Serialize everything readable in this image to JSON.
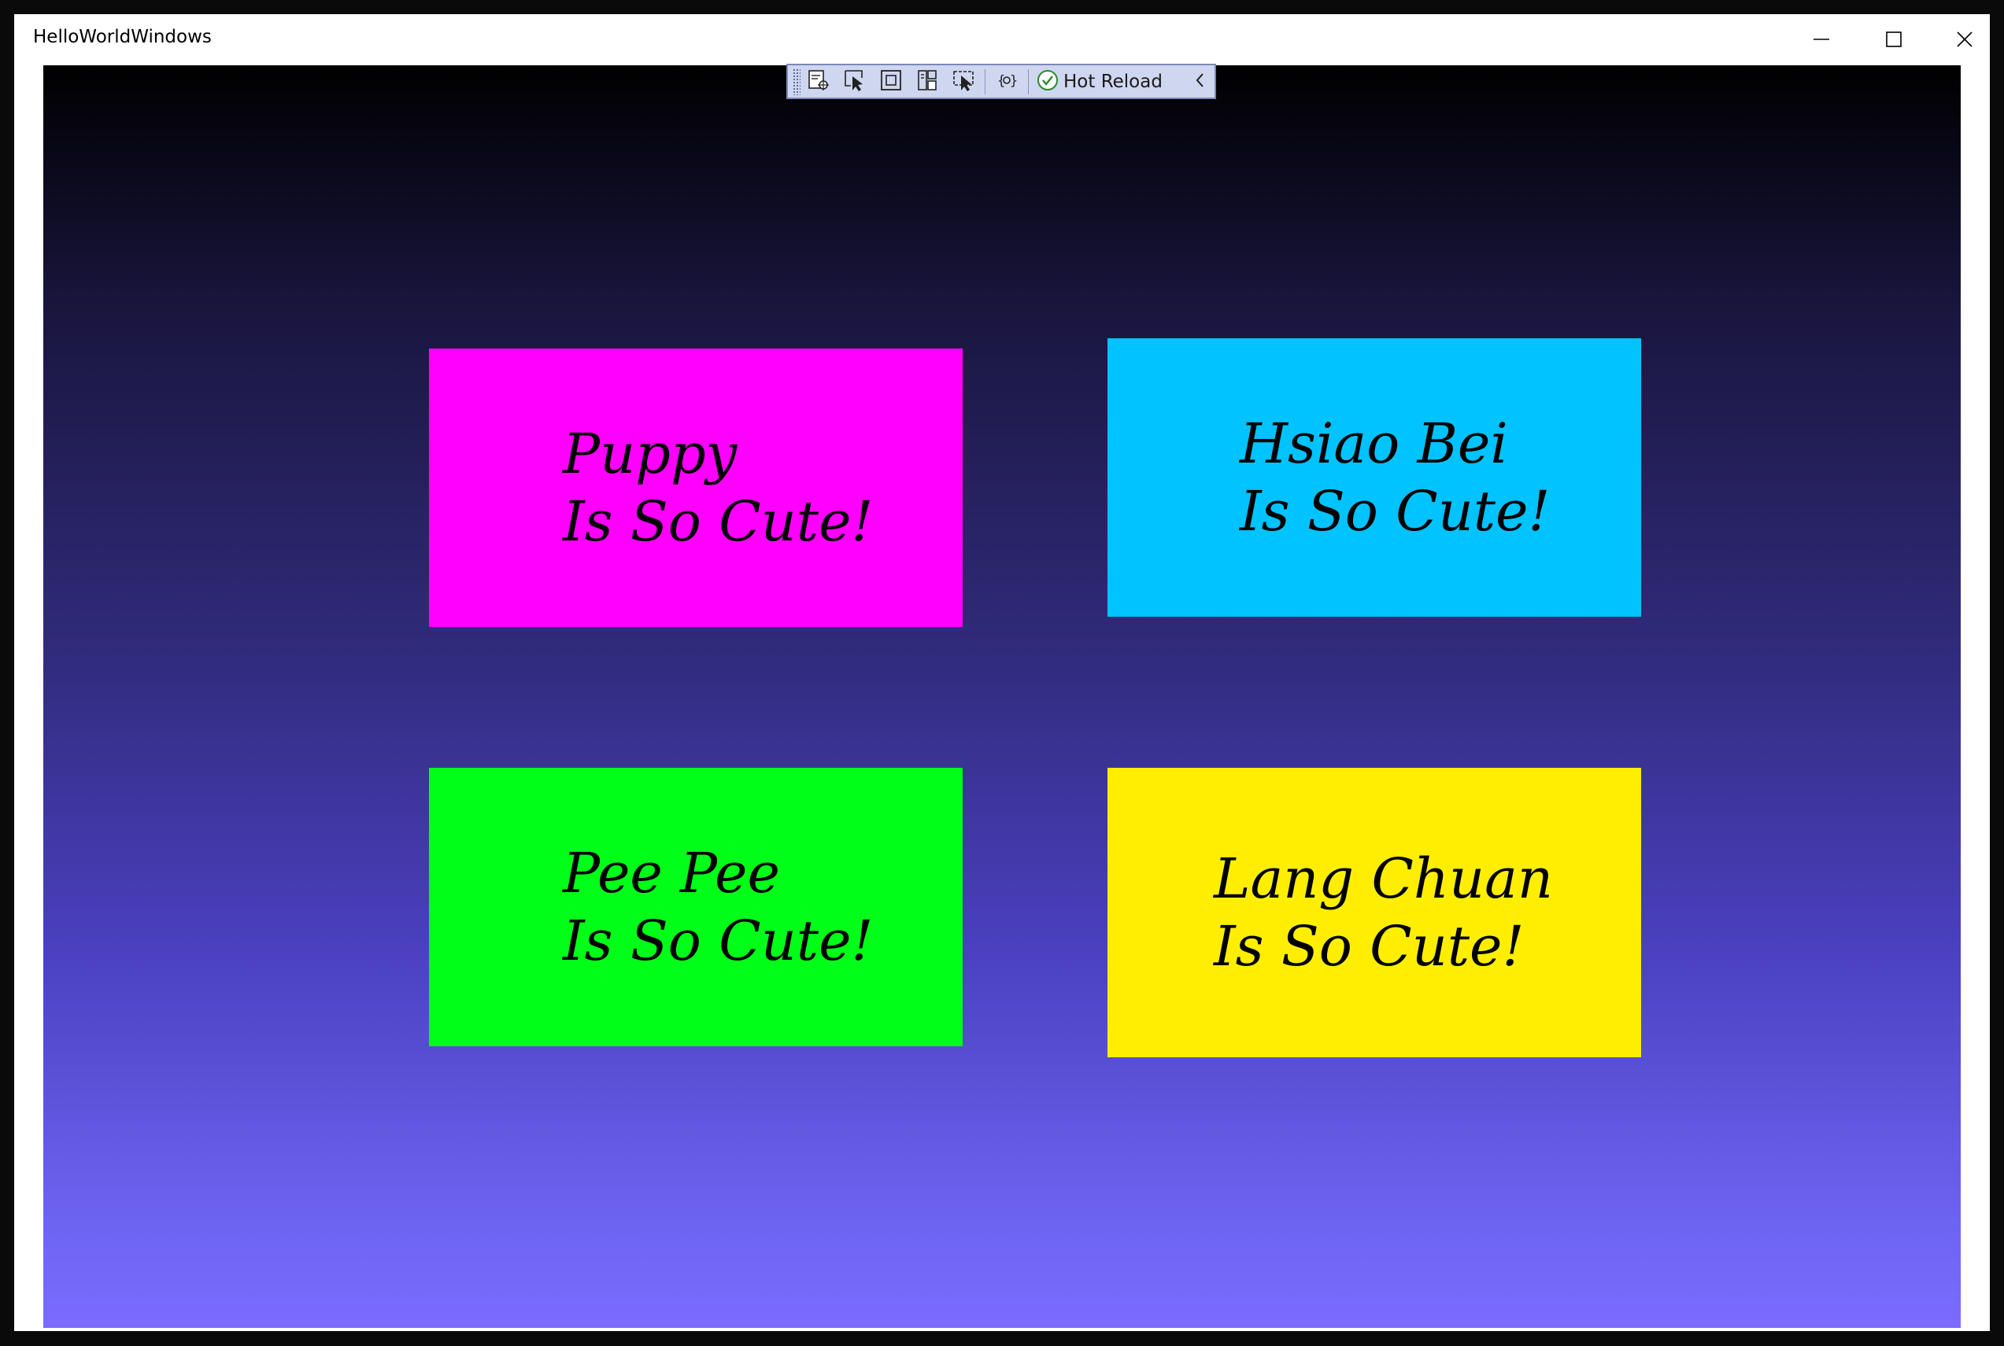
{
  "window": {
    "title": "HelloWorldWindows",
    "minimize_icon": "minimize-icon",
    "maximize_icon": "maximize-icon",
    "close_icon": "close-icon"
  },
  "hot_reload_toolbar": {
    "tools": [
      {
        "icon": "live-visual-tree-icon"
      },
      {
        "icon": "select-element-icon"
      },
      {
        "icon": "display-layout-adorners-icon"
      },
      {
        "icon": "track-focus-icon"
      },
      {
        "icon": "binding-failures-icon"
      },
      {
        "icon": "xaml-binding-icon"
      }
    ],
    "status_icon": "checkmark-circle-icon",
    "status_label": "Hot Reload",
    "collapse_icon": "chevron-left-icon"
  },
  "cards": [
    {
      "name": "Puppy",
      "line1": "Puppy",
      "line2": "Is So Cute!",
      "color": "#ff00ff"
    },
    {
      "name": "Hsiao Bei",
      "line1": "Hsiao Bei",
      "line2": "Is So Cute!",
      "color": "#00c3ff"
    },
    {
      "name": "Pee Pee",
      "line1": "Pee Pee",
      "line2": "Is So Cute!",
      "color": "#00ff18"
    },
    {
      "name": "Lang Chuan",
      "line1": "Lang Chuan",
      "line2": "Is So Cute!",
      "color": "#ffee00"
    }
  ],
  "colors": {
    "gradient_top": "#000000",
    "gradient_bottom": "#7a6cff",
    "toolbar_bg": "#cfd6ef"
  }
}
